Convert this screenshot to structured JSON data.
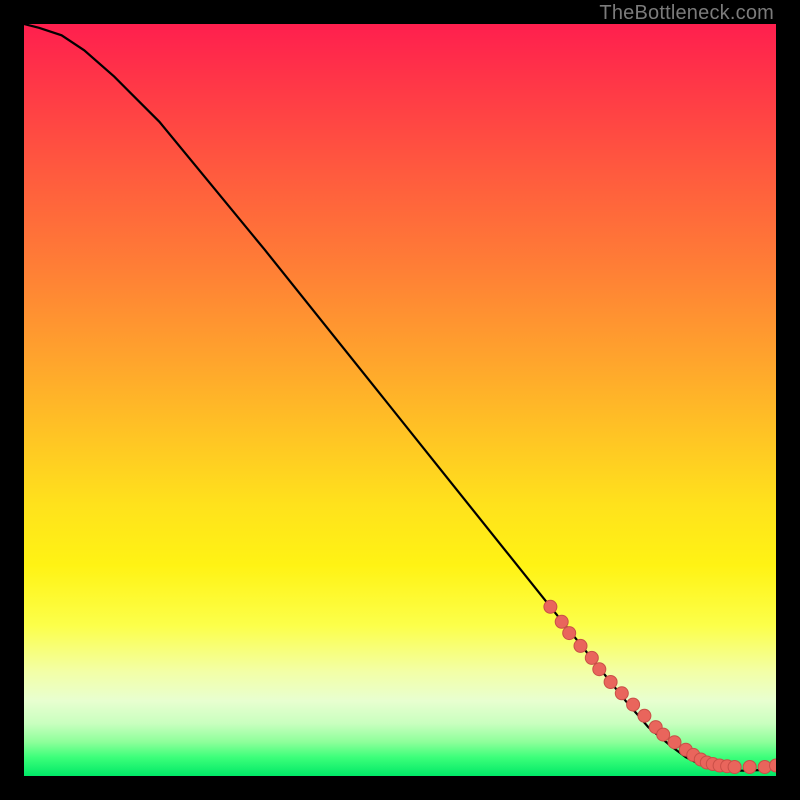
{
  "watermark": "TheBottleneck.com",
  "chart_data": {
    "type": "line",
    "title": "",
    "xlabel": "",
    "ylabel": "",
    "xlim": [
      0,
      100
    ],
    "ylim": [
      0,
      100
    ],
    "x": [
      0,
      2,
      5,
      8,
      12,
      18,
      25,
      32,
      40,
      48,
      56,
      64,
      70,
      76,
      80,
      83,
      86,
      88,
      90,
      92,
      94,
      96,
      98,
      100
    ],
    "y": [
      100,
      99.5,
      98.5,
      96.5,
      93,
      87,
      78.5,
      70,
      60,
      50,
      40,
      30,
      22.5,
      15,
      10,
      6.5,
      4,
      2.5,
      1.5,
      1,
      0.7,
      0.7,
      0.8,
      1.2
    ],
    "markers_x": [
      70,
      71.5,
      72.5,
      74,
      75.5,
      76.5,
      78,
      79.5,
      81,
      82.5,
      84,
      85,
      86.5,
      88,
      89,
      90,
      90.8,
      91.6,
      92.5,
      93.5,
      94.5,
      96.5,
      98.5,
      100
    ],
    "markers_y": [
      22.5,
      20.5,
      19,
      17.3,
      15.7,
      14.2,
      12.5,
      11,
      9.5,
      8,
      6.5,
      5.5,
      4.5,
      3.5,
      2.8,
      2.2,
      1.8,
      1.6,
      1.4,
      1.3,
      1.2,
      1.2,
      1.2,
      1.4
    ],
    "colors": {
      "line": "#000000",
      "marker_fill": "#e9655c",
      "marker_stroke": "#c94f47"
    }
  }
}
